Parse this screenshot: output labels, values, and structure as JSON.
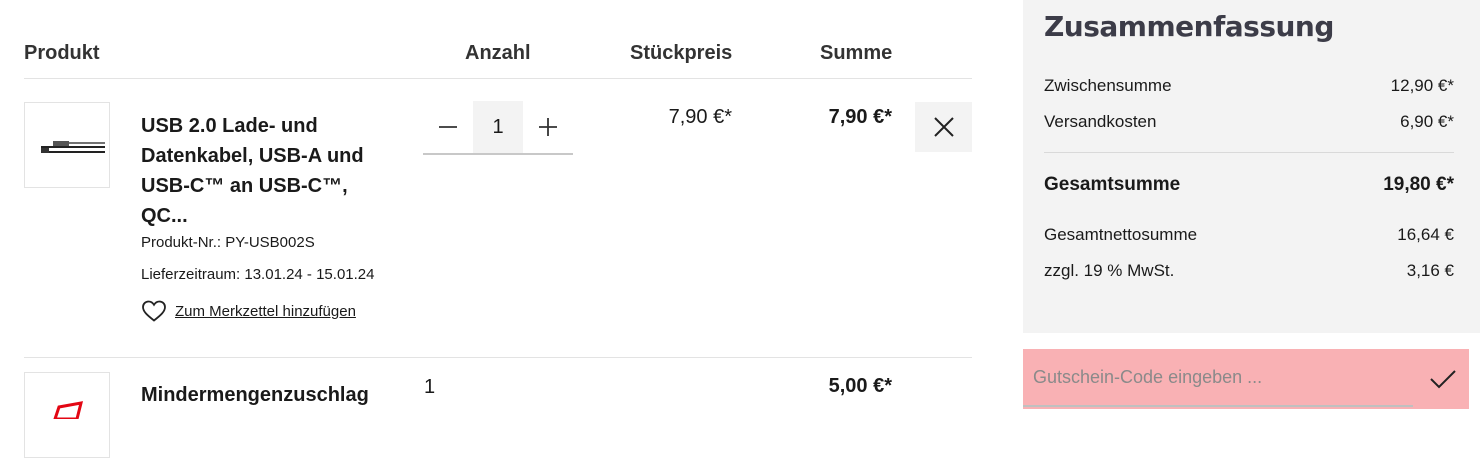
{
  "table": {
    "headers": {
      "product": "Produkt",
      "quantity": "Anzahl",
      "unit_price": "Stückpreis",
      "sum": "Summe"
    }
  },
  "items": [
    {
      "name": "USB 2.0 Lade- und Datenkabel, USB-A und USB-C™ an USB-C™, QC...",
      "product_number": "Produkt-Nr.: PY-USB002S",
      "delivery": "Lieferzeitraum: 13.01.24 - 15.01.24",
      "wishlist_label": "Zum Merkzettel hinzufügen",
      "quantity": "1",
      "unit_price": "7,90 €*",
      "sum": "7,90 €*",
      "icons": {
        "thumbnail": "usb-cable-image",
        "minus": "minus-icon",
        "plus": "plus-icon",
        "remove": "close-icon",
        "wishlist": "heart-icon"
      }
    },
    {
      "name": "Mindermengenzuschlag",
      "quantity": "1",
      "sum": "5,00 €*",
      "icons": {
        "thumbnail": "surcharge-icon"
      }
    }
  ],
  "summary": {
    "title": "Zusammenfassung",
    "subtotal_label": "Zwischensumme",
    "subtotal_value": "12,90 €*",
    "shipping_label": "Versandkosten",
    "shipping_value": "6,90 €*",
    "total_label": "Gesamtsumme",
    "total_value": "19,80 €*",
    "net_label": "Gesamtnettosumme",
    "net_value": "16,64 €",
    "vat_label": "zzgl. 19 % MwSt.",
    "vat_value": "3,16 €"
  },
  "voucher": {
    "placeholder": "Gutschein-Code eingeben ...",
    "submit_icon": "checkmark-icon"
  },
  "colors": {
    "summary_bg": "#f3f3f3",
    "voucher_highlight": "#f9b1b4",
    "surcharge_red": "#e30613",
    "title_color": "#3c3c48"
  }
}
